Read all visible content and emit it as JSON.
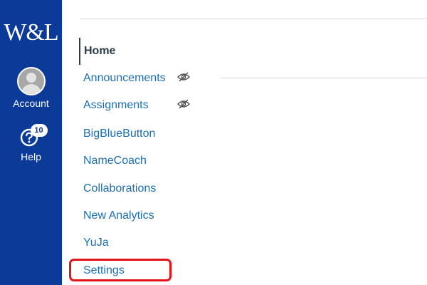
{
  "global_nav": {
    "logo_text": "W&L",
    "account_label": "Account",
    "help_label": "Help",
    "help_badge_count": "10",
    "background_color": "#0b3a99"
  },
  "course_nav": {
    "items": [
      {
        "label": "Home",
        "active": true,
        "hidden_icon": false
      },
      {
        "label": "Announcements",
        "active": false,
        "hidden_icon": true
      },
      {
        "label": "Assignments",
        "active": false,
        "hidden_icon": true
      },
      {
        "label": "BigBlueButton",
        "active": false,
        "hidden_icon": false
      },
      {
        "label": "NameCoach",
        "active": false,
        "hidden_icon": false
      },
      {
        "label": "Collaborations",
        "active": false,
        "hidden_icon": false
      },
      {
        "label": "New Analytics",
        "active": false,
        "hidden_icon": false
      },
      {
        "label": "YuJa",
        "active": false,
        "hidden_icon": false
      },
      {
        "label": "Settings",
        "active": false,
        "hidden_icon": false,
        "highlighted": true
      }
    ],
    "link_color": "#1d6fb0",
    "active_color": "#2d3b45",
    "highlight_color": "#e3131b",
    "hidden_icon_name": "eye-slash-icon"
  }
}
